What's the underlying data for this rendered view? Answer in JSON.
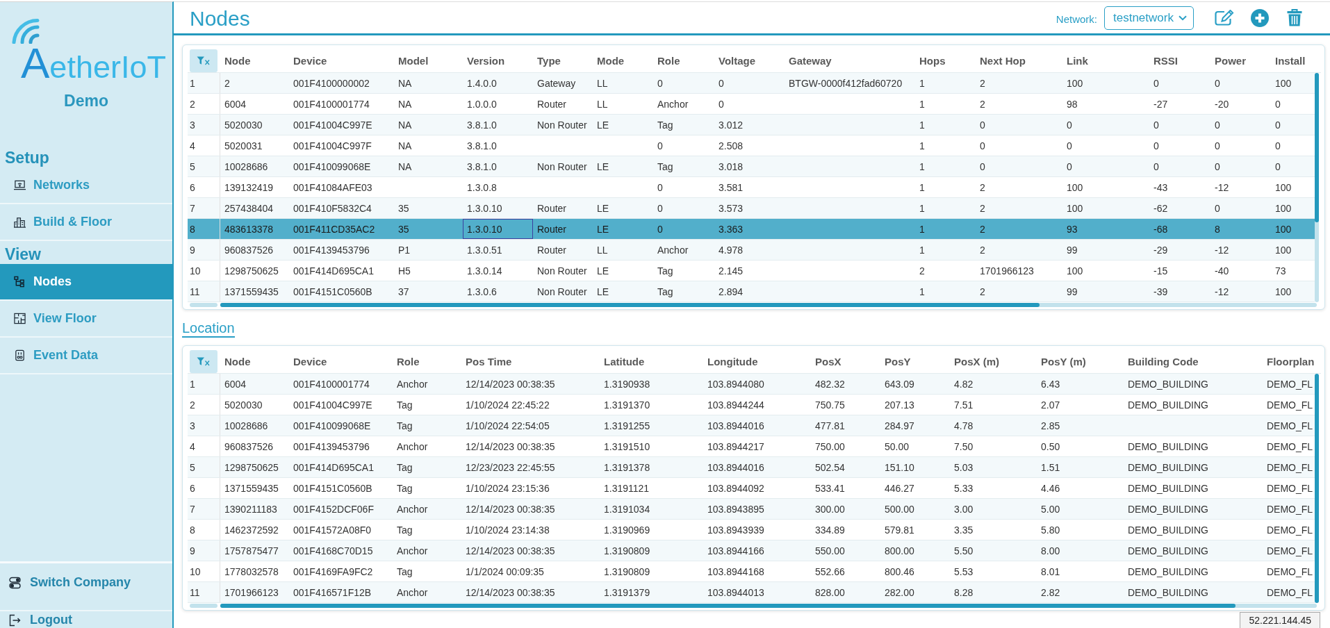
{
  "sidebar": {
    "logo": {
      "text": "AetherIoT"
    },
    "company": "Demo",
    "sections": [
      {
        "heading": "Setup",
        "items": [
          {
            "label": "Networks",
            "selected": false
          },
          {
            "label": "Build & Floor",
            "selected": false
          }
        ]
      },
      {
        "heading": "View",
        "items": [
          {
            "label": "Nodes",
            "selected": true
          },
          {
            "label": "View Floor",
            "selected": false
          },
          {
            "label": "Event Data",
            "selected": false
          }
        ]
      }
    ],
    "footer_items": [
      {
        "label": "Switch Company"
      },
      {
        "label": "Logout"
      }
    ]
  },
  "header": {
    "title": "Nodes",
    "network_label": "Network:",
    "network_select": {
      "value": "testnetwork"
    }
  },
  "nodes_table": {
    "columns": [
      "Node",
      "Device",
      "Model",
      "Version",
      "Type",
      "Mode",
      "Role",
      "Voltage",
      "Gateway",
      "Hops",
      "Next Hop",
      "Link",
      "RSSI",
      "Power",
      "Install"
    ],
    "rows": [
      {
        "number": "1",
        "selected": false,
        "cells": [
          "2",
          "001F4100000002",
          "NA",
          "1.4.0.0",
          "Gateway",
          "LL",
          "0",
          "0",
          "BTGW-0000f412fad60720",
          "1",
          "2",
          "100",
          "0",
          "0",
          "100"
        ]
      },
      {
        "number": "2",
        "selected": false,
        "cells": [
          "6004",
          "001F4100001774",
          "NA",
          "1.0.0.0",
          "Router",
          "LL",
          "Anchor",
          "0",
          null,
          "1",
          "2",
          "98",
          "-27",
          "-20",
          "0"
        ]
      },
      {
        "number": "3",
        "selected": false,
        "cells": [
          "5020030",
          "001F41004C997E",
          "NA",
          "3.8.1.0",
          "Non Router",
          "LE",
          "Tag",
          "3.012",
          null,
          "1",
          "0",
          "0",
          "0",
          "0",
          "0"
        ]
      },
      {
        "number": "4",
        "selected": false,
        "cells": [
          "5020031",
          "001F41004C997F",
          "NA",
          "3.8.1.0",
          null,
          null,
          "0",
          "2.508",
          null,
          "1",
          "0",
          "0",
          "0",
          "0",
          "0"
        ]
      },
      {
        "number": "5",
        "selected": false,
        "cells": [
          "10028686",
          "001F410099068E",
          "NA",
          "3.8.1.0",
          "Non Router",
          "LE",
          "Tag",
          "3.018",
          null,
          "1",
          "0",
          "0",
          "0",
          "0",
          "0"
        ]
      },
      {
        "number": "6",
        "selected": false,
        "cells": [
          "139132419",
          "001F41084AFE03",
          null,
          "1.3.0.8",
          null,
          null,
          "0",
          "3.581",
          null,
          "1",
          "2",
          "100",
          "-43",
          "-12",
          "100"
        ]
      },
      {
        "number": "7",
        "selected": false,
        "cells": [
          "257438404",
          "001F410F5832C4",
          "35",
          "1.3.0.10",
          "Router",
          "LE",
          "0",
          "3.573",
          null,
          "1",
          "2",
          "100",
          "-62",
          "0",
          "100"
        ]
      },
      {
        "number": "8",
        "selected": true,
        "cells": [
          "483613378",
          "001F411CD35AC2",
          "35",
          {
            "text": "1.3.0.10",
            "focused": true
          },
          "Router",
          "LE",
          "0",
          "3.363",
          null,
          "1",
          "2",
          "93",
          "-68",
          "8",
          "100"
        ]
      },
      {
        "number": "9",
        "selected": false,
        "cells": [
          "960837526",
          "001F4139453796",
          "P1",
          "1.3.0.51",
          "Router",
          "LL",
          "Anchor",
          "4.978",
          null,
          "1",
          "2",
          "99",
          "-29",
          "-12",
          "100"
        ]
      },
      {
        "number": "10",
        "selected": false,
        "cells": [
          "1298750625",
          "001F414D695CA1",
          "H5",
          "1.3.0.14",
          "Non Router",
          "LE",
          "Tag",
          "2.145",
          null,
          "2",
          "1701966123",
          "100",
          "-15",
          "-40",
          "73"
        ]
      },
      {
        "number": "11",
        "selected": false,
        "cells": [
          "1371559435",
          "001F4151C0560B",
          "37",
          "1.3.0.6",
          "Non Router",
          "LE",
          "Tag",
          "2.894",
          null,
          "1",
          "2",
          "99",
          "-39",
          "-12",
          "100"
        ]
      }
    ]
  },
  "location": {
    "title": "Location",
    "table": {
      "columns": [
        "Node",
        "Device",
        "Role",
        "Pos Time",
        "Latitude",
        "Longitude",
        "PosX",
        "PosY",
        "PosX (m)",
        "PosY (m)",
        "Building Code",
        "Floorplan"
      ],
      "rows": [
        {
          "number": "1",
          "cells": [
            "6004",
            "001F4100001774",
            "Anchor",
            "12/14/2023 00:38:35",
            "1.3190938",
            "103.8944080",
            "482.32",
            "643.09",
            "4.82",
            "6.43",
            "DEMO_BUILDING",
            "DEMO_FL"
          ]
        },
        {
          "number": "2",
          "cells": [
            "5020030",
            "001F41004C997E",
            "Tag",
            "1/10/2024 22:45:22",
            "1.3191370",
            "103.8944244",
            "750.75",
            "207.13",
            "7.51",
            "2.07",
            "DEMO_BUILDING",
            "DEMO_FL"
          ]
        },
        {
          "number": "3",
          "cells": [
            "10028686",
            "001F410099068E",
            "Tag",
            "1/10/2024 22:54:05",
            "1.3191255",
            "103.8944016",
            "477.81",
            "284.97",
            "4.78",
            "2.85",
            null,
            "DEMO_FL"
          ]
        },
        {
          "number": "4",
          "cells": [
            "960837526",
            "001F4139453796",
            "Anchor",
            "12/14/2023 00:38:35",
            "1.3191510",
            "103.8944217",
            "750.00",
            "50.00",
            "7.50",
            "0.50",
            "DEMO_BUILDING",
            "DEMO_FL"
          ]
        },
        {
          "number": "5",
          "cells": [
            "1298750625",
            "001F414D695CA1",
            "Tag",
            "12/23/2023 22:45:55",
            "1.3191378",
            "103.8944016",
            "502.54",
            "151.10",
            "5.03",
            "1.51",
            "DEMO_BUILDING",
            "DEMO_FL"
          ]
        },
        {
          "number": "6",
          "cells": [
            "1371559435",
            "001F4151C0560B",
            "Tag",
            "1/10/2024 23:15:36",
            "1.3191121",
            "103.8944092",
            "533.41",
            "446.27",
            "5.33",
            "4.46",
            "DEMO_BUILDING",
            "DEMO_FL"
          ]
        },
        {
          "number": "7",
          "cells": [
            "1390211183",
            "001F4152DCF06F",
            "Anchor",
            "12/14/2023 00:38:35",
            "1.3191034",
            "103.8943895",
            "300.00",
            "500.00",
            "3.00",
            "5.00",
            "DEMO_BUILDING",
            "DEMO_FL"
          ]
        },
        {
          "number": "8",
          "cells": [
            "1462372592",
            "001F41572A08F0",
            "Tag",
            "1/10/2024 23:14:38",
            "1.3190969",
            "103.8943939",
            "334.89",
            "579.81",
            "3.35",
            "5.80",
            "DEMO_BUILDING",
            "DEMO_FL"
          ]
        },
        {
          "number": "9",
          "cells": [
            "1757875477",
            "001F4168C70D15",
            "Anchor",
            "12/14/2023 00:38:35",
            "1.3190809",
            "103.8944166",
            "550.00",
            "800.00",
            "5.50",
            "8.00",
            "DEMO_BUILDING",
            "DEMO_FL"
          ]
        },
        {
          "number": "10",
          "cells": [
            "1778032578",
            "001F4169FA9FC2",
            "Tag",
            "1/1/2024 00:09:35",
            "1.3190809",
            "103.8944168",
            "552.66",
            "800.46",
            "5.53",
            "8.01",
            "DEMO_BUILDING",
            "DEMO_FL"
          ]
        },
        {
          "number": "11",
          "cells": [
            "1701966123",
            "001F416571F12B",
            "Anchor",
            "12/14/2023 00:38:35",
            "1.3191379",
            "103.8944013",
            "828.00",
            "282.00",
            "8.28",
            "2.82",
            "DEMO_BUILDING",
            "DEMO_FL"
          ]
        }
      ]
    }
  },
  "server_address": "52.221.144.45"
}
